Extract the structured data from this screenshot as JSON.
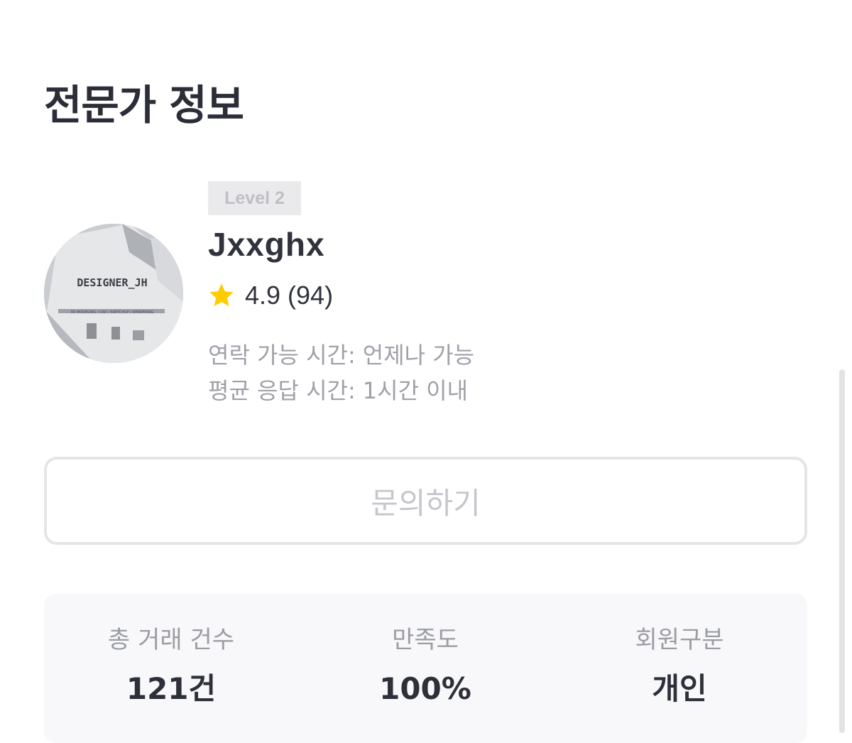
{
  "section": {
    "title": "전문가 정보"
  },
  "expert": {
    "level": "Level 2",
    "name": "Jxxghx",
    "avatar_text": "DESIGNER_JH",
    "avatar_subtext": "3D MODELING / CAD / SKETCHUP / RENDERING",
    "rating": "4.9",
    "review_count": "(94)",
    "contact_label": "연락 가능 시간:",
    "contact_value": "언제나 가능",
    "response_label": "평균 응답 시간:",
    "response_value": "1시간 이내"
  },
  "inquiry_button": {
    "label": "문의하기"
  },
  "stats": [
    {
      "label": "총 거래 건수",
      "value": "121건"
    },
    {
      "label": "만족도",
      "value": "100%"
    },
    {
      "label": "회원구분",
      "value": "개인"
    }
  ],
  "colors": {
    "star": "#FFCC00",
    "title": "#2B2E38",
    "muted": "#9FA1A8",
    "badge_bg": "#EAEAEC",
    "panel_bg": "#F8F8FA"
  },
  "icons": {
    "rating": "star-icon"
  }
}
